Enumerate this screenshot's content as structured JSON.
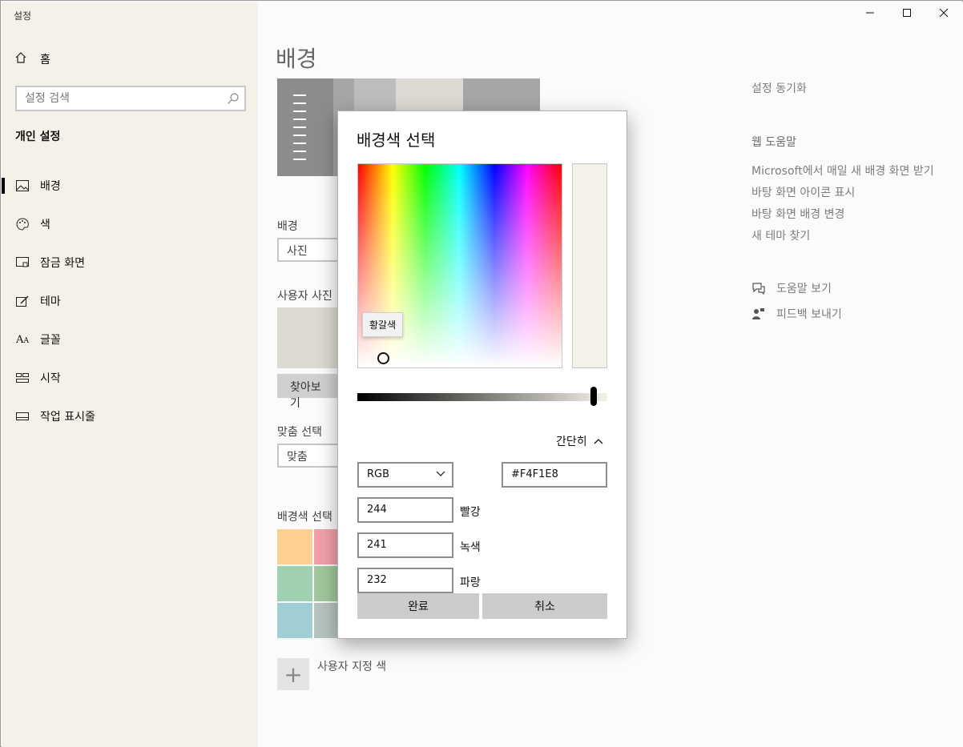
{
  "window": {
    "title": "설정"
  },
  "sidebar": {
    "home_label": "홈",
    "search_placeholder": "설정 검색",
    "section_title": "개인 설정",
    "items": [
      {
        "label": "배경",
        "icon": "picture-icon",
        "active": true
      },
      {
        "label": "색",
        "icon": "palette-icon"
      },
      {
        "label": "잠금 화면",
        "icon": "lock-screen-icon"
      },
      {
        "label": "테마",
        "icon": "theme-brush-icon"
      },
      {
        "label": "글꼴",
        "icon": "font-icon"
      },
      {
        "label": "시작",
        "icon": "start-icon"
      },
      {
        "label": "작업 표시줄",
        "icon": "taskbar-icon"
      }
    ]
  },
  "main": {
    "page_title": "배경",
    "background_label": "배경",
    "background_value": "사진",
    "your_picture_label": "사용자 사진",
    "browse_label": "찾아보기",
    "fit_label": "맞춤 선택",
    "fit_value": "맞춤",
    "bg_color_label": "배경색 선택",
    "custom_color_label": "사용자 지정 색",
    "swatch_colors": [
      "#ffd08f",
      "#f3a0a8",
      "#9fd0b0",
      "#a0c89c",
      "#9fcfd4",
      "#b8c4c0"
    ]
  },
  "right": {
    "sync_link": "설정 동기화",
    "help_title": "웹 도움말",
    "links": [
      "Microsoft에서 매일 새 배경 화면 받기",
      "바탕 화면 아이콘 표시",
      "바탕 화면 배경 변경",
      "새 테마 찾기"
    ],
    "get_help": "도움말 보기",
    "feedback": "피드백 보내기"
  },
  "dialog": {
    "title": "배경색 선택",
    "tooltip": "황갈색",
    "less_label": "간단히",
    "mode": "RGB",
    "hex": "#F4F1E8",
    "red_value": "244",
    "red_label": "빨강",
    "green_value": "241",
    "green_label": "녹색",
    "blue_value": "232",
    "blue_label": "파랑",
    "done_label": "완료",
    "cancel_label": "취소",
    "selected_color": "#f4f1e8"
  }
}
